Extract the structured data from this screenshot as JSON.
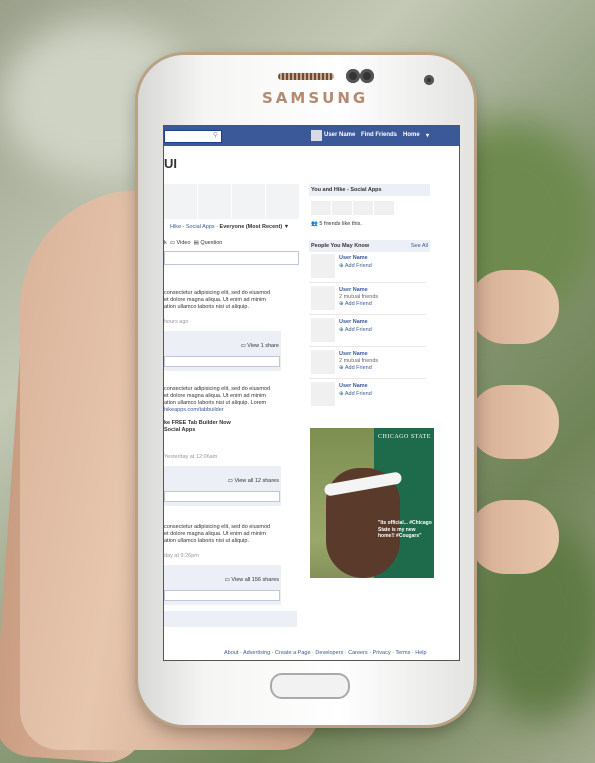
{
  "device": {
    "brand": "SAMSUNG"
  },
  "topbar": {
    "user_name": "User Name",
    "find_friends": "Find Friends",
    "home": "Home"
  },
  "page": {
    "title": "UI",
    "filter_link": "Hike - Social Apps",
    "filter_value": "Everyone (Most Recent) ▼",
    "actions": [
      "k",
      "Video",
      "Question"
    ]
  },
  "posts": [
    {
      "text": [
        "consectetur adipisicing elit, sed do eiusmod",
        "et dolore magna aliqua. Ut enim ad minim",
        "ation ullamco laboris nisi ut aliquip."
      ],
      "time": "hours ago",
      "share": "View 1 share"
    },
    {
      "text": [
        "consectetur adipisicing elit, sed do eiusmod",
        "et dolore magna aliqua. Ut enim ad minim",
        "ation ullamco laboris nisi ut aliquip. Lorem",
        "hikeapps.com/tabbuilder"
      ],
      "link": [
        "ke FREE Tab Builder Now",
        "Social Apps"
      ],
      "time": "Yesterday at 12:06am",
      "share": "View all 12 shares"
    },
    {
      "text": [
        "consectetur adipisicing elit, sed do eiusmod",
        "et dolore magna aliqua. Ut enim ad minim",
        "ation ullamco laboris nisi ut aliquip."
      ],
      "time": "day at 9:26pm",
      "share": "View all 156 shares"
    }
  ],
  "sidebar": {
    "page_box": "You and Hike - Social Apps",
    "likes": "5 friends like this.",
    "pymk_title": "People You May Know",
    "see_all": "See All",
    "people": [
      {
        "name": "User Name",
        "mutual": "",
        "add": "Add Friend"
      },
      {
        "name": "User Name",
        "mutual": "2 mutual friends",
        "add": "Add Friend"
      },
      {
        "name": "User Name",
        "mutual": "",
        "add": "Add Friend"
      },
      {
        "name": "User Name",
        "mutual": "2 mutual friends",
        "add": "Add Friend"
      },
      {
        "name": "User Name",
        "mutual": "",
        "add": "Add Friend"
      }
    ]
  },
  "ad": {
    "brand": "CHICAGO STATE",
    "quote": "\"Its official... #Chicago State is my new home!! #Cougars\""
  },
  "footer": "About · Advertising · Create a Page · Developers · Careers · Privacy · Terms · Help"
}
